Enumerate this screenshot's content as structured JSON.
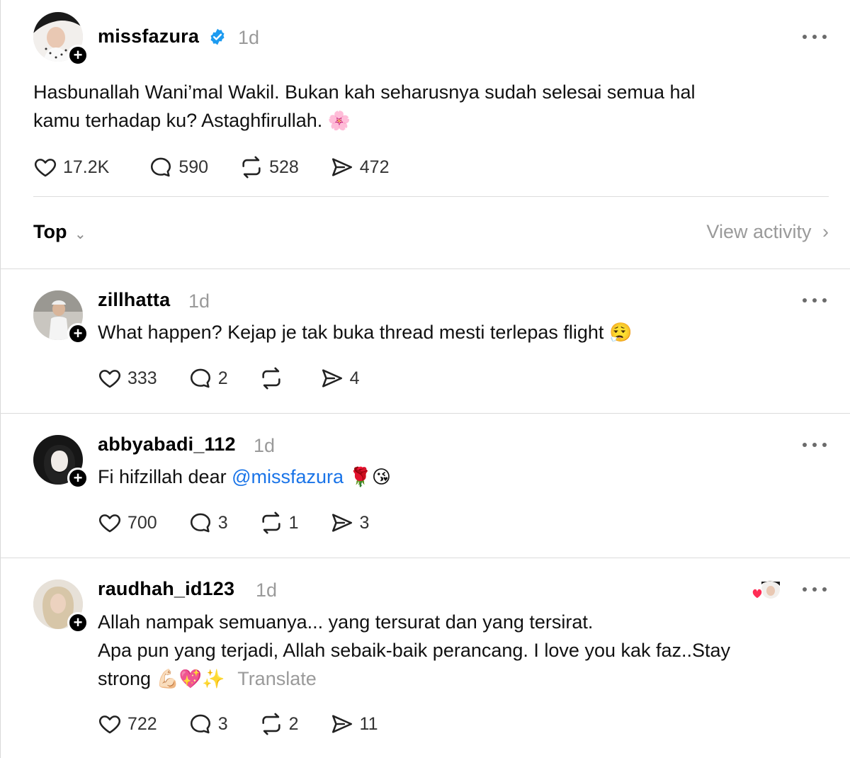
{
  "main_post": {
    "username": "missfazura",
    "time": "1d",
    "text_line1": "Hasbunallah Wani’mal Wakil. Bukan kah seharusnya sudah selesai semua hal",
    "text_line2": "kamu terhadap ku? Astaghfirullah.",
    "emoji": "🌸",
    "likes": "17.2K",
    "replies": "590",
    "reposts": "528",
    "shares": "472"
  },
  "sort": {
    "label": "Top",
    "view_activity": "View activity"
  },
  "replies": [
    {
      "username": "zillhatta",
      "time": "1d",
      "text": "What happen? Kejap je tak buka thread mesti terlepas flight",
      "emoji": "😮‍💨",
      "likes": "333",
      "replies": "2",
      "reposts": "",
      "shares": "4"
    },
    {
      "username": "abbyabadi_112",
      "time": "1d",
      "text_prefix": "Fi hifzillah dear ",
      "mention": "@missfazura",
      "emoji": "🌹😘",
      "likes": "700",
      "replies": "3",
      "reposts": "1",
      "shares": "3"
    },
    {
      "username": "raudhah_id123",
      "time": "1d",
      "line1": "Allah nampak semuanya... yang tersurat dan yang tersirat.",
      "line2": "Apa pun yang terjadi, Allah sebaik-baik perancang. I love you kak faz..Stay",
      "line3": "strong",
      "emoji": "💪🏻💖✨",
      "translate": "Translate",
      "likes": "722",
      "replies": "3",
      "reposts": "2",
      "shares": "11"
    }
  ],
  "icons": {
    "like": "heart-icon",
    "reply": "speech-bubble-icon",
    "repost": "repost-icon",
    "share": "paper-plane-icon",
    "more": "more-horizontal-icon",
    "verified": "verified-badge-icon",
    "follow": "plus-icon"
  },
  "colors": {
    "verified": "#1d9bf0",
    "mention": "#1a74e8",
    "muted": "#9a9a9a"
  }
}
